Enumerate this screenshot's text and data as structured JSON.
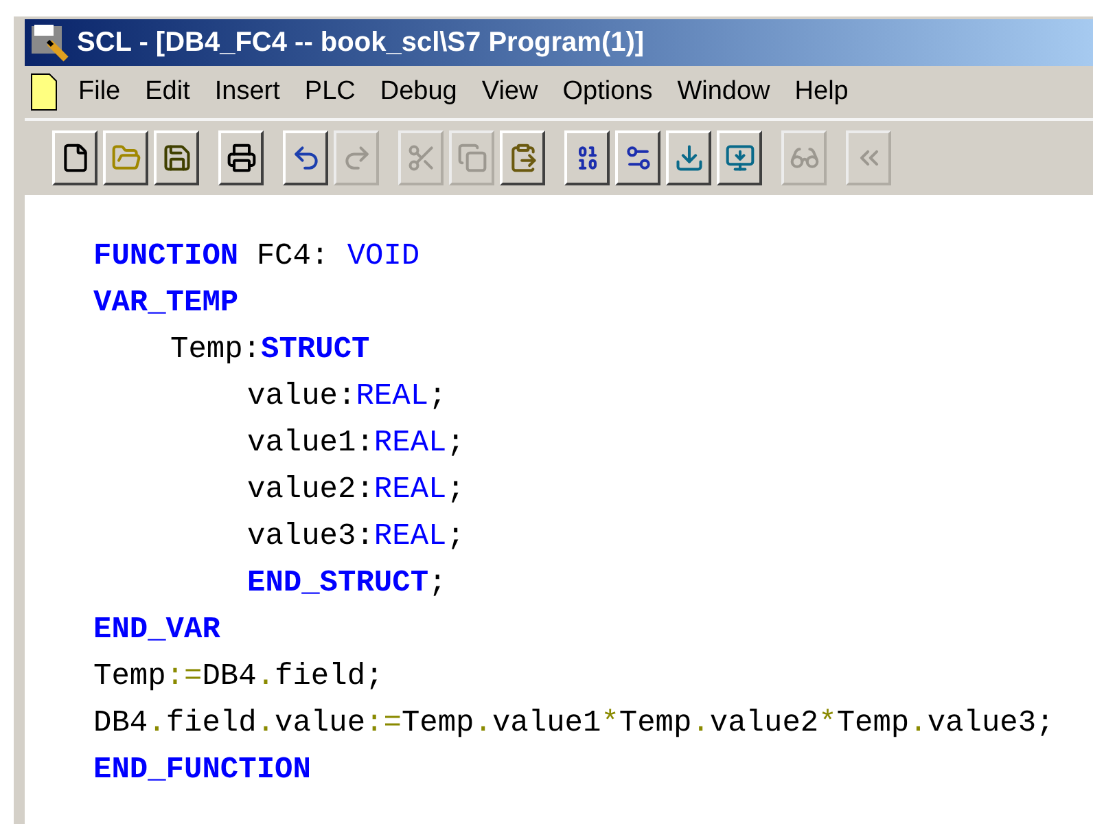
{
  "window": {
    "title": "SCL - [DB4_FC4 -- book_scl\\S7 Program(1)]"
  },
  "menu": [
    "File",
    "Edit",
    "Insert",
    "PLC",
    "Debug",
    "View",
    "Options",
    "Window",
    "Help"
  ],
  "toolbar": [
    [
      {
        "kind": "new",
        "disabled": false
      },
      {
        "kind": "open",
        "disabled": false
      },
      {
        "kind": "save",
        "disabled": false
      }
    ],
    [
      {
        "kind": "print",
        "disabled": false
      }
    ],
    [
      {
        "kind": "undo",
        "disabled": false
      },
      {
        "kind": "redo",
        "disabled": true
      }
    ],
    [
      {
        "kind": "cut",
        "disabled": true
      },
      {
        "kind": "copy",
        "disabled": true
      },
      {
        "kind": "paste",
        "disabled": false
      }
    ],
    [
      {
        "kind": "compile",
        "disabled": false
      },
      {
        "kind": "compile_settings",
        "disabled": false
      },
      {
        "kind": "download",
        "disabled": false
      },
      {
        "kind": "download_settings",
        "disabled": false
      }
    ],
    [
      {
        "kind": "monitor",
        "disabled": true
      }
    ],
    [
      {
        "kind": "breakpoint",
        "disabled": true
      }
    ]
  ],
  "code": [
    {
      "tokens": [
        {
          "text": "FUNCTION",
          "kind": "keyword"
        },
        {
          "text": "FC4:",
          "kind": "ident",
          "space": true
        },
        {
          "text": "VOID",
          "kind": "type",
          "space": true
        }
      ]
    },
    {
      "tokens": [
        {
          "text": "VAR_TEMP",
          "kind": "keyword"
        }
      ],
      "children": [
        {
          "tokens": [
            {
              "text": "Temp:",
              "kind": "ident"
            },
            {
              "text": "STRUCT",
              "kind": "keyword"
            }
          ],
          "children": [
            {
              "tokens": [
                {
                  "text": "value:",
                  "kind": "ident"
                },
                {
                  "text": "REAL",
                  "kind": "type"
                },
                {
                  "text": ";",
                  "kind": "ident"
                }
              ]
            },
            {
              "tokens": [
                {
                  "text": "value1:",
                  "kind": "ident"
                },
                {
                  "text": "REAL",
                  "kind": "type"
                },
                {
                  "text": ";",
                  "kind": "ident"
                }
              ]
            },
            {
              "tokens": [
                {
                  "text": "value2:",
                  "kind": "ident"
                },
                {
                  "text": "REAL",
                  "kind": "type"
                },
                {
                  "text": ";",
                  "kind": "ident"
                }
              ]
            },
            {
              "tokens": [
                {
                  "text": "value3:",
                  "kind": "ident"
                },
                {
                  "text": "REAL",
                  "kind": "type"
                },
                {
                  "text": ";",
                  "kind": "ident"
                }
              ]
            },
            {
              "tokens": [
                {
                  "text": "END_STRUCT",
                  "kind": "keyword"
                },
                {
                  "text": ";",
                  "kind": "ident"
                }
              ]
            }
          ]
        }
      ]
    },
    {
      "tokens": [
        {
          "text": "END_VAR",
          "kind": "keyword"
        }
      ]
    },
    {
      "tokens": [
        {
          "text": "Temp",
          "kind": "ident"
        },
        {
          "text": ":=",
          "kind": "op"
        },
        {
          "text": "DB4",
          "kind": "ident"
        },
        {
          "text": ".",
          "kind": "op"
        },
        {
          "text": "field;",
          "kind": "ident"
        }
      ]
    },
    {
      "tokens": [
        {
          "text": "DB4",
          "kind": "ident"
        },
        {
          "text": ".",
          "kind": "op"
        },
        {
          "text": "field",
          "kind": "ident"
        },
        {
          "text": ".",
          "kind": "op"
        },
        {
          "text": "value",
          "kind": "ident"
        },
        {
          "text": ":=",
          "kind": "op"
        },
        {
          "text": "Temp",
          "kind": "ident"
        },
        {
          "text": ".",
          "kind": "op"
        },
        {
          "text": "value1",
          "kind": "ident"
        },
        {
          "text": "*",
          "kind": "op"
        },
        {
          "text": "Temp",
          "kind": "ident"
        },
        {
          "text": ".",
          "kind": "op"
        },
        {
          "text": "value2",
          "kind": "ident"
        },
        {
          "text": "*",
          "kind": "op"
        },
        {
          "text": "Temp",
          "kind": "ident"
        },
        {
          "text": ".",
          "kind": "op"
        },
        {
          "text": "value3;",
          "kind": "ident"
        }
      ]
    },
    {
      "tokens": [
        {
          "text": "END_FUNCTION",
          "kind": "keyword"
        }
      ]
    }
  ]
}
